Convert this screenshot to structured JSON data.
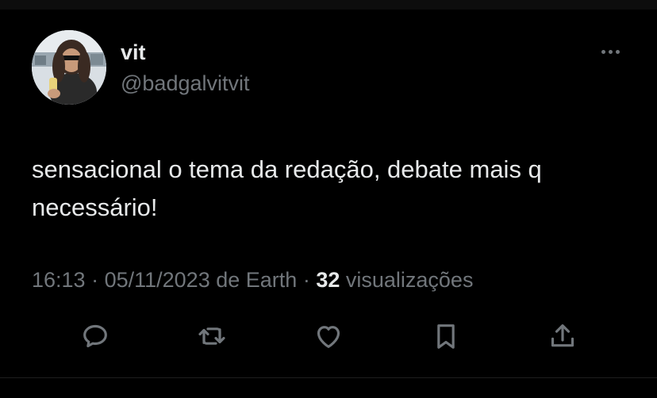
{
  "author": {
    "name": "vit",
    "handle": "@badgalvitvit"
  },
  "tweet": {
    "text": "sensacional o tema da redação, debate mais q necessário!",
    "time": "16:13",
    "date": "05/11/2023",
    "source": "de Earth",
    "views_count": "32",
    "views_label": "visualizações"
  },
  "icons": {
    "more": "more-horizontal-icon",
    "reply": "reply-icon",
    "retweet": "retweet-icon",
    "like": "like-icon",
    "bookmark": "bookmark-icon",
    "share": "share-icon"
  },
  "colors": {
    "background": "#000000",
    "text_primary": "#e7e9ea",
    "text_secondary": "#71767b"
  }
}
